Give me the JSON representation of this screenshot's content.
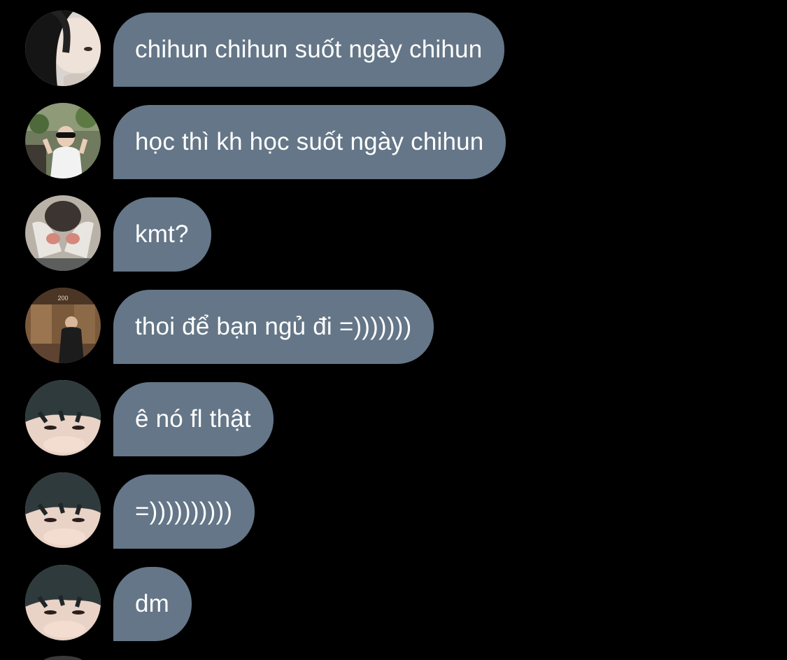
{
  "messages": [
    {
      "text": "chihun chihun suốt ngày chihun",
      "avatar": "avatar-1"
    },
    {
      "text": "học thì kh học suốt ngày chihun",
      "avatar": "avatar-2"
    },
    {
      "text": "kmt?",
      "avatar": "avatar-3"
    },
    {
      "text": "thoi để bạn ngủ đi =)))))))",
      "avatar": "avatar-4"
    },
    {
      "text": "ê nó fl thật",
      "avatar": "avatar-5"
    },
    {
      "text": "=))))))))))",
      "avatar": "avatar-5"
    },
    {
      "text": "dm",
      "avatar": "avatar-5"
    }
  ],
  "colors": {
    "background": "#000000",
    "bubble": "#647687",
    "text": "#ffffff"
  }
}
